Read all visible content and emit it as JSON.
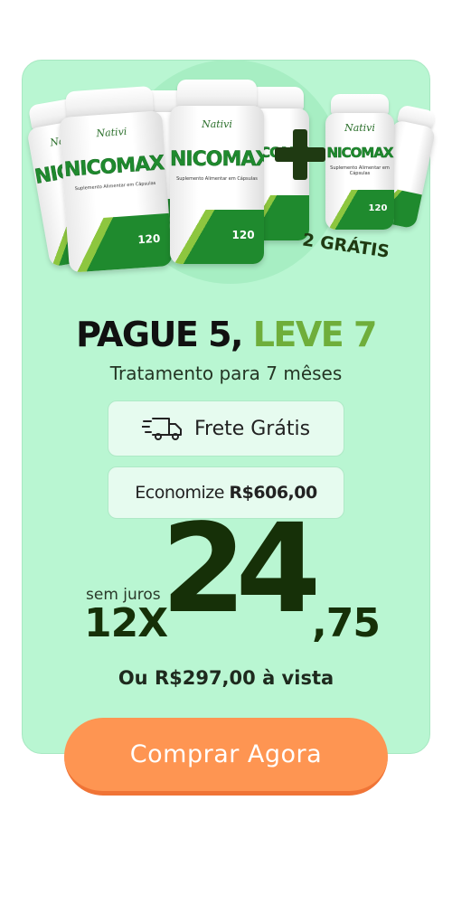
{
  "product": {
    "brand": "Nativi",
    "name": "NICOMAX",
    "subtitle": "Suplemento Alimentar em Cápsulas",
    "capsule_count": "120"
  },
  "bonus_label": "2 GRÁTIS",
  "offer": {
    "headline_prefix": "PAGUE 5,",
    "headline_highlight": "LEVE 7",
    "treatment": "Tratamento para 7 mêses"
  },
  "shipping": {
    "label": "Frete Grátis",
    "icon": "truck-icon"
  },
  "savings": {
    "label": "Economize",
    "amount": "R$606,00"
  },
  "price": {
    "installment_note": "sem juros",
    "installments": "12X",
    "integer": "24",
    "cents": ",75",
    "cash_text": "Ou R$297,00 à vista"
  },
  "cta": {
    "label": "Comprar Agora"
  },
  "colors": {
    "card_bg": "#b9f6d2",
    "highlight_green": "#6fae3b",
    "price_dark": "#163008",
    "cta_orange": "#fe9552"
  }
}
